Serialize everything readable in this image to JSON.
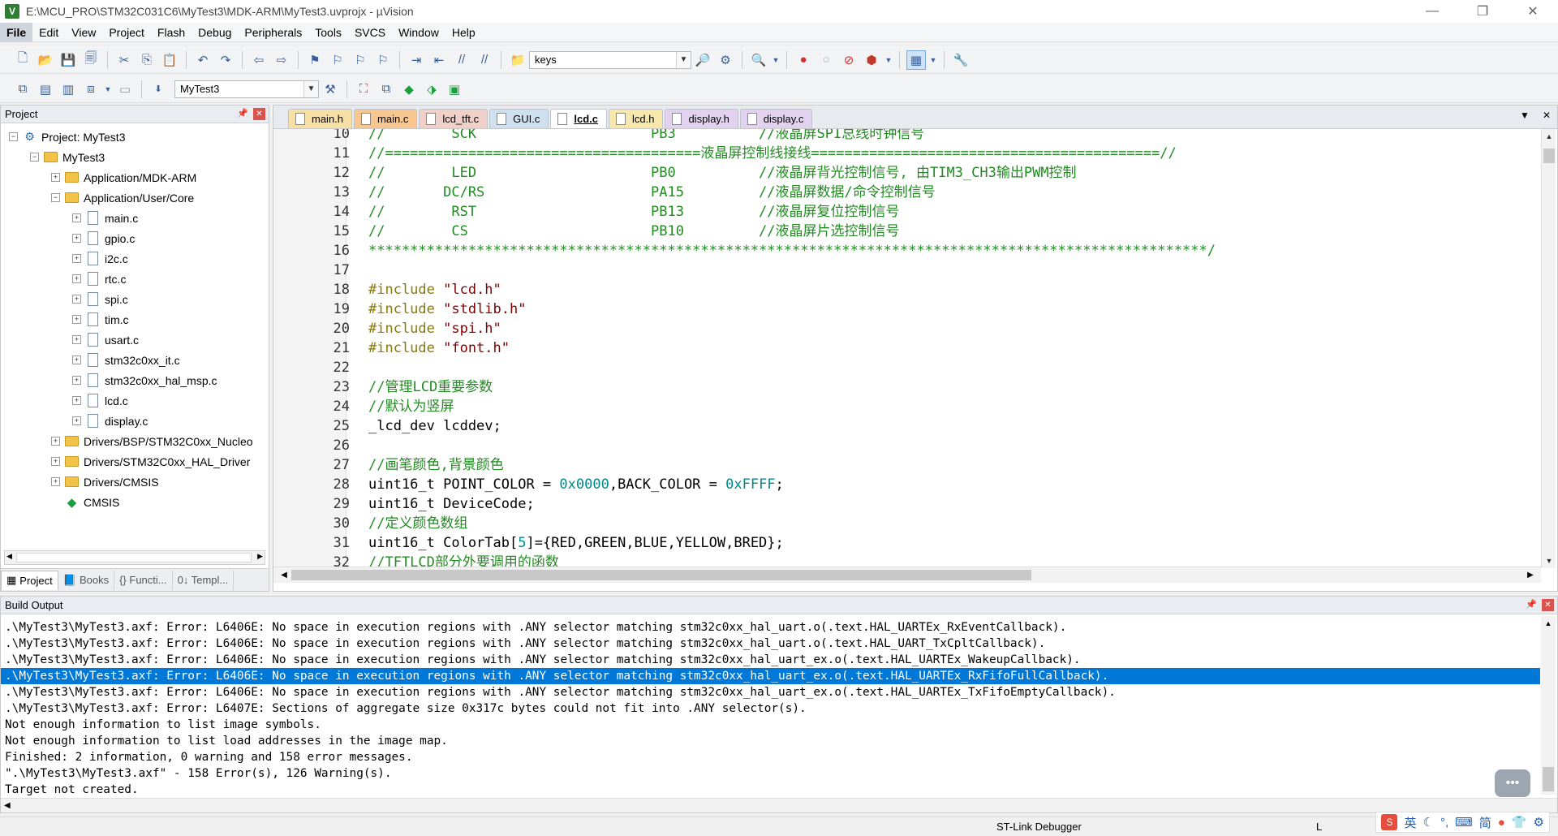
{
  "window": {
    "title": "E:\\MCU_PRO\\STM32C031C6\\MyTest3\\MDK-ARM\\MyTest3.uvprojx - µVision",
    "minimize": "—",
    "restore": "❐",
    "close": "✕"
  },
  "menu": [
    "File",
    "Edit",
    "View",
    "Project",
    "Flash",
    "Debug",
    "Peripherals",
    "Tools",
    "SVCS",
    "Window",
    "Help"
  ],
  "toolbar1": {
    "search_value": "keys"
  },
  "toolbar2": {
    "target_value": "MyTest3"
  },
  "project_panel": {
    "title": "Project",
    "tree": [
      {
        "label": "Project: MyTest3",
        "level": 0,
        "type": "project",
        "exp": "−"
      },
      {
        "label": "MyTest3",
        "level": 1,
        "type": "folder",
        "exp": "−"
      },
      {
        "label": "Application/MDK-ARM",
        "level": 2,
        "type": "folder",
        "exp": "+"
      },
      {
        "label": "Application/User/Core",
        "level": 2,
        "type": "folder",
        "exp": "−"
      },
      {
        "label": "main.c",
        "level": 3,
        "type": "file",
        "exp": "+"
      },
      {
        "label": "gpio.c",
        "level": 3,
        "type": "file",
        "exp": "+"
      },
      {
        "label": "i2c.c",
        "level": 3,
        "type": "file",
        "exp": "+"
      },
      {
        "label": "rtc.c",
        "level": 3,
        "type": "file",
        "exp": "+"
      },
      {
        "label": "spi.c",
        "level": 3,
        "type": "file",
        "exp": "+"
      },
      {
        "label": "tim.c",
        "level": 3,
        "type": "file",
        "exp": "+"
      },
      {
        "label": "usart.c",
        "level": 3,
        "type": "file",
        "exp": "+"
      },
      {
        "label": "stm32c0xx_it.c",
        "level": 3,
        "type": "file",
        "exp": "+"
      },
      {
        "label": "stm32c0xx_hal_msp.c",
        "level": 3,
        "type": "file",
        "exp": "+"
      },
      {
        "label": "lcd.c",
        "level": 3,
        "type": "file",
        "exp": "+"
      },
      {
        "label": "display.c",
        "level": 3,
        "type": "file",
        "exp": "+"
      },
      {
        "label": "Drivers/BSP/STM32C0xx_Nucleo",
        "level": 2,
        "type": "folder",
        "exp": "+"
      },
      {
        "label": "Drivers/STM32C0xx_HAL_Driver",
        "level": 2,
        "type": "folder",
        "exp": "+"
      },
      {
        "label": "Drivers/CMSIS",
        "level": 2,
        "type": "folder",
        "exp": "+"
      },
      {
        "label": "CMSIS",
        "level": 2,
        "type": "cmsis",
        "exp": ""
      }
    ],
    "tabs": [
      "Project",
      "Books",
      "{} Functi...",
      "0↓ Templ..."
    ]
  },
  "editor": {
    "tabs": [
      "main.h",
      "main.c",
      "lcd_tft.c",
      "GUI.c",
      "lcd.c",
      "lcd.h",
      "display.h",
      "display.c"
    ],
    "active_tab": "lcd.c",
    "lines": [
      {
        "n": "10",
        "parts": [
          [
            "com",
            "//        SCK                     PB3          //液晶屏SPI总线时钟信号"
          ]
        ]
      },
      {
        "n": "11",
        "parts": [
          [
            "com",
            "//======================================液晶屏控制线接线==========================================//"
          ]
        ]
      },
      {
        "n": "12",
        "parts": [
          [
            "com",
            "//        LED                     PB0          //液晶屏背光控制信号, 由TIM3_CH3输出PWM控制"
          ]
        ]
      },
      {
        "n": "13",
        "parts": [
          [
            "com",
            "//       DC/RS                    PA15         //液晶屏数据/命令控制信号"
          ]
        ]
      },
      {
        "n": "14",
        "parts": [
          [
            "com",
            "//        RST                     PB13         //液晶屏复位控制信号"
          ]
        ]
      },
      {
        "n": "15",
        "parts": [
          [
            "com",
            "//        CS                      PB10         //液晶屏片选控制信号"
          ]
        ]
      },
      {
        "n": "16",
        "parts": [
          [
            "com",
            "*****************************************************************************************************/"
          ]
        ]
      },
      {
        "n": "17",
        "parts": [
          [
            "plain",
            ""
          ]
        ]
      },
      {
        "n": "18",
        "parts": [
          [
            "pre",
            "#include "
          ],
          [
            "str",
            "\"lcd.h\""
          ]
        ]
      },
      {
        "n": "19",
        "parts": [
          [
            "pre",
            "#include "
          ],
          [
            "str",
            "\"stdlib.h\""
          ]
        ]
      },
      {
        "n": "20",
        "parts": [
          [
            "pre",
            "#include "
          ],
          [
            "str",
            "\"spi.h\""
          ]
        ]
      },
      {
        "n": "21",
        "parts": [
          [
            "pre",
            "#include "
          ],
          [
            "str",
            "\"font.h\""
          ]
        ]
      },
      {
        "n": "22",
        "parts": [
          [
            "plain",
            ""
          ]
        ]
      },
      {
        "n": "23",
        "parts": [
          [
            "com",
            "//管理LCD重要参数"
          ]
        ]
      },
      {
        "n": "24",
        "parts": [
          [
            "com",
            "//默认为竖屏"
          ]
        ]
      },
      {
        "n": "25",
        "parts": [
          [
            "plain",
            "_lcd_dev lcddev;"
          ]
        ]
      },
      {
        "n": "26",
        "parts": [
          [
            "plain",
            ""
          ]
        ]
      },
      {
        "n": "27",
        "parts": [
          [
            "com",
            "//画笔颜色,背景颜色"
          ]
        ]
      },
      {
        "n": "28",
        "parts": [
          [
            "plain",
            "uint16_t POINT_COLOR = "
          ],
          [
            "num",
            "0x0000"
          ],
          [
            "plain",
            ",BACK_COLOR = "
          ],
          [
            "num",
            "0xFFFF"
          ],
          [
            "plain",
            ";"
          ]
        ]
      },
      {
        "n": "29",
        "parts": [
          [
            "plain",
            "uint16_t DeviceCode;"
          ]
        ]
      },
      {
        "n": "30",
        "parts": [
          [
            "com",
            "//定义颜色数组"
          ]
        ]
      },
      {
        "n": "31",
        "parts": [
          [
            "plain",
            "uint16_t ColorTab["
          ],
          [
            "num",
            "5"
          ],
          [
            "plain",
            "]={RED,GREEN,BLUE,YELLOW,BRED};"
          ]
        ]
      },
      {
        "n": "32",
        "parts": [
          [
            "com",
            "//TFTLCD部分外要调用的函数"
          ]
        ]
      }
    ]
  },
  "build_output": {
    "title": "Build Output",
    "lines": [
      ".\\MyTest3\\MyTest3.axf: Error: L6406E: No space in execution regions with .ANY selector matching stm32c0xx_hal_uart.o(.text.HAL_UARTEx_RxEventCallback).",
      ".\\MyTest3\\MyTest3.axf: Error: L6406E: No space in execution regions with .ANY selector matching stm32c0xx_hal_uart.o(.text.HAL_UART_TxCpltCallback).",
      ".\\MyTest3\\MyTest3.axf: Error: L6406E: No space in execution regions with .ANY selector matching stm32c0xx_hal_uart_ex.o(.text.HAL_UARTEx_WakeupCallback).",
      ".\\MyTest3\\MyTest3.axf: Error: L6406E: No space in execution regions with .ANY selector matching stm32c0xx_hal_uart_ex.o(.text.HAL_UARTEx_RxFifoFullCallback).",
      ".\\MyTest3\\MyTest3.axf: Error: L6406E: No space in execution regions with .ANY selector matching stm32c0xx_hal_uart_ex.o(.text.HAL_UARTEx_TxFifoEmptyCallback).",
      ".\\MyTest3\\MyTest3.axf: Error: L6407E: Sections of aggregate size 0x317c bytes could not fit into .ANY selector(s).",
      "Not enough information to list image symbols.",
      "Not enough information to list load addresses in the image map.",
      "Finished: 2 information, 0 warning and 158 error messages.",
      "\".\\MyTest3\\MyTest3.axf\" - 158 Error(s), 126 Warning(s).",
      "Target not created."
    ],
    "selected_index": 3
  },
  "status": {
    "debugger": "ST-Link Debugger",
    "cursor": "L"
  },
  "ime": {
    "lang": "英",
    "simplified": "简"
  }
}
